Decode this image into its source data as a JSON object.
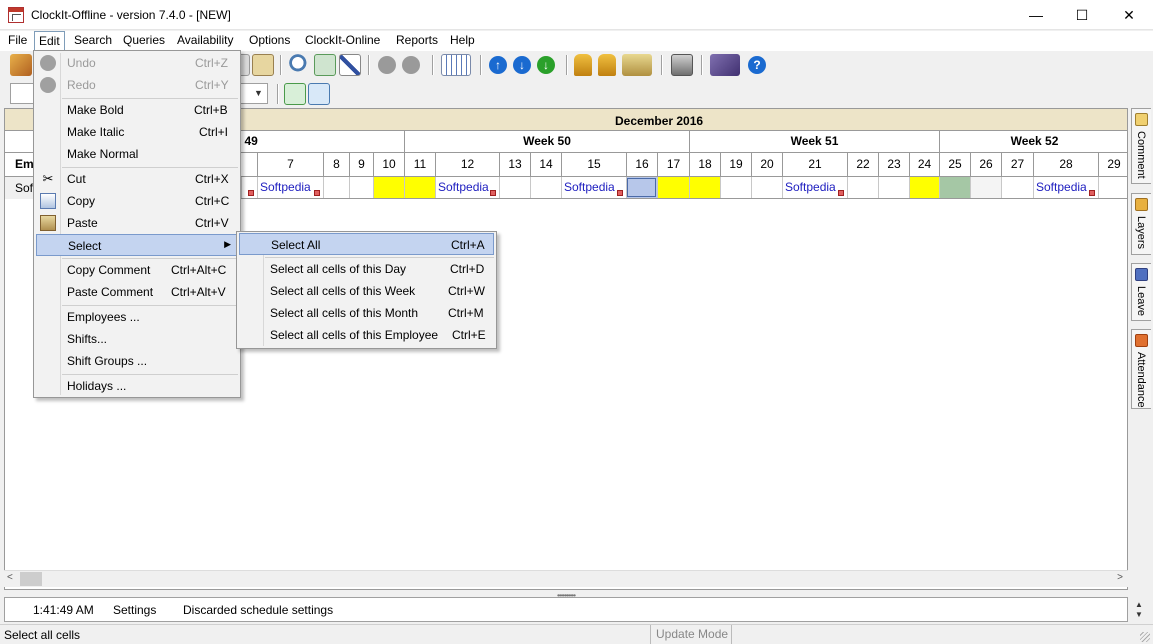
{
  "window": {
    "title": "ClockIt-Offline - version  7.4.0 - [NEW]",
    "min_glyph": "—",
    "max_glyph": "☐",
    "close_glyph": "✕"
  },
  "menubar": [
    "File",
    "Edit",
    "Search",
    "Queries",
    "Availability",
    "Options",
    "ClockIt-Online",
    "Reports",
    "Help"
  ],
  "grid": {
    "month": "December 2016",
    "emp_header": "Em",
    "emp_name": "Softpe",
    "weeks": [
      "Week 49",
      "Week 50",
      "Week 51",
      "Week 52"
    ],
    "days": [
      "7",
      "8",
      "9",
      "10",
      "11",
      "12",
      "13",
      "14",
      "15",
      "16",
      "17",
      "18",
      "19",
      "20",
      "21",
      "22",
      "23",
      "24",
      "25",
      "26",
      "27",
      "28",
      "29"
    ],
    "entry_text": "Softpedia"
  },
  "edit_menu": {
    "items": [
      {
        "label": "Undo",
        "shortcut": "Ctrl+Z",
        "enabled": false,
        "icon": "undo-icon"
      },
      {
        "label": "Redo",
        "shortcut": "Ctrl+Y",
        "enabled": false,
        "icon": "redo-icon"
      },
      {
        "label": "Make Bold",
        "shortcut": "Ctrl+B"
      },
      {
        "label": "Make Italic",
        "shortcut": "Ctrl+I"
      },
      {
        "label": "Make Normal",
        "shortcut": ""
      },
      {
        "label": "Cut",
        "shortcut": "Ctrl+X",
        "icon": "scissors-icon"
      },
      {
        "label": "Copy",
        "shortcut": "Ctrl+C",
        "icon": "copy-icon"
      },
      {
        "label": "Paste",
        "shortcut": "Ctrl+V",
        "icon": "paste-icon"
      },
      {
        "label": "Select",
        "shortcut": "",
        "submenu": true
      },
      {
        "label": "Copy Comment",
        "shortcut": "Ctrl+Alt+C"
      },
      {
        "label": "Paste Comment",
        "shortcut": "Ctrl+Alt+V"
      },
      {
        "label": "Employees ...",
        "shortcut": ""
      },
      {
        "label": "Shifts...",
        "shortcut": ""
      },
      {
        "label": "Shift Groups ...",
        "shortcut": ""
      },
      {
        "label": "Holidays ...",
        "shortcut": ""
      }
    ]
  },
  "select_submenu": {
    "items": [
      {
        "label": "Select All",
        "shortcut": "Ctrl+A"
      },
      {
        "label": "Select all cells of this Day",
        "shortcut": "Ctrl+D"
      },
      {
        "label": "Select all cells of this Week",
        "shortcut": "Ctrl+W"
      },
      {
        "label": "Select all cells of this Month",
        "shortcut": "Ctrl+M"
      },
      {
        "label": "Select all cells of this Employee",
        "shortcut": "Ctrl+E"
      }
    ]
  },
  "side_tabs": [
    "Comment",
    "Layers",
    "Leave",
    "Attendance"
  ],
  "log": {
    "time": "1:41:49 AM",
    "category": "Settings",
    "message": "Discarded schedule settings"
  },
  "status": {
    "left": "Select all cells",
    "mode": "Update Mode"
  },
  "colors": {
    "highlight_yellow": "#ffff00",
    "selected_cell": "#b7c7ea",
    "weekend_green": "#a5c7a5",
    "menu_highlight": "#c4d4f0",
    "entry_text": "#2020c0"
  }
}
